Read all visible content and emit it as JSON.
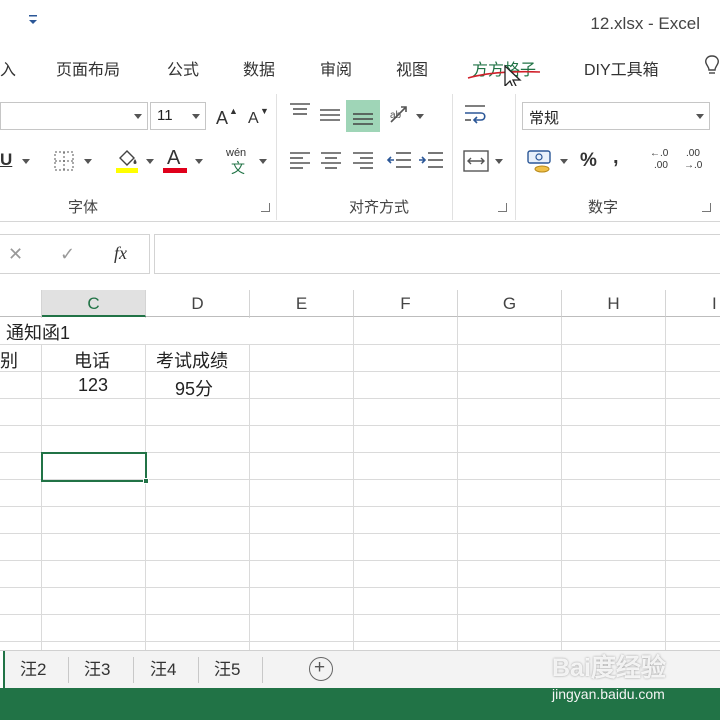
{
  "window": {
    "title": "12.xlsx - Excel"
  },
  "ribbon_tabs": [
    {
      "label": "入"
    },
    {
      "label": "页面布局"
    },
    {
      "label": "公式"
    },
    {
      "label": "数据"
    },
    {
      "label": "审阅"
    },
    {
      "label": "视图"
    },
    {
      "label": "方方格子"
    },
    {
      "label": "DIY工具箱"
    }
  ],
  "font_group": {
    "label": "字体",
    "font_size": "11",
    "increase_font": "A",
    "decrease_font": "A",
    "underline": "U",
    "font_color_glyph": "A",
    "phonetic_top": "wén",
    "phonetic_bottom": "文"
  },
  "alignment_group": {
    "label": "对齐方式"
  },
  "number_group": {
    "label": "数字",
    "format_value": "常规",
    "percent": "%",
    "comma": ",",
    "increase_decimal_top": "←.0",
    "increase_decimal_bottom": ".00",
    "decrease_decimal_top": ".00",
    "decrease_decimal_bottom": "→.0"
  },
  "formula_bar": {
    "cancel": "✕",
    "enter": "✓",
    "fx": "fx",
    "content": ""
  },
  "columns": [
    "C",
    "D",
    "E",
    "F",
    "G",
    "H",
    "I"
  ],
  "cells": {
    "title_fragment": "通知函1",
    "b_header_fragment": "别",
    "c_header": "电话",
    "d_header": "考试成绩",
    "c_value": "123",
    "d_value": "95分"
  },
  "sheets": [
    "汪2",
    "汪3",
    "汪4",
    "汪5"
  ],
  "add_sheet": "+",
  "watermark": {
    "logo": "Bai度经验",
    "url": "jingyan.baidu.com"
  },
  "colors": {
    "accent": "#217346",
    "font_color_bar": "#e0001b",
    "fill_color_bar": "#ffff00"
  }
}
